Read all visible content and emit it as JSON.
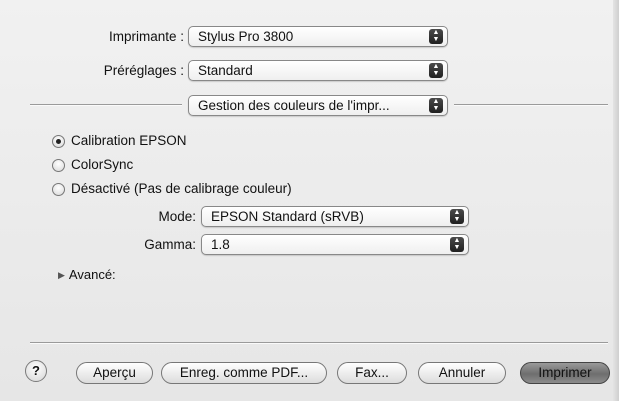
{
  "printer": {
    "label": "Imprimante :",
    "value": "Stylus Pro 3800"
  },
  "presets": {
    "label": "Préréglages :",
    "value": "Standard"
  },
  "panel": {
    "value": "Gestion des couleurs de l'impr..."
  },
  "color_options": [
    {
      "label": "Calibration EPSON",
      "selected": true
    },
    {
      "label": "ColorSync",
      "selected": false
    },
    {
      "label": "Désactivé (Pas de calibrage couleur)",
      "selected": false
    }
  ],
  "mode": {
    "label": "Mode:",
    "value": "EPSON Standard (sRVB)"
  },
  "gamma": {
    "label": "Gamma:",
    "value": "1.8"
  },
  "advanced": {
    "label": "Avancé:"
  },
  "buttons": {
    "help": "?",
    "preview": "Aperçu",
    "save_pdf": "Enreg. comme PDF...",
    "fax": "Fax...",
    "cancel": "Annuler",
    "print": "Imprimer"
  },
  "stepper_glyphs": {
    "up": "▲",
    "down": "▼"
  }
}
